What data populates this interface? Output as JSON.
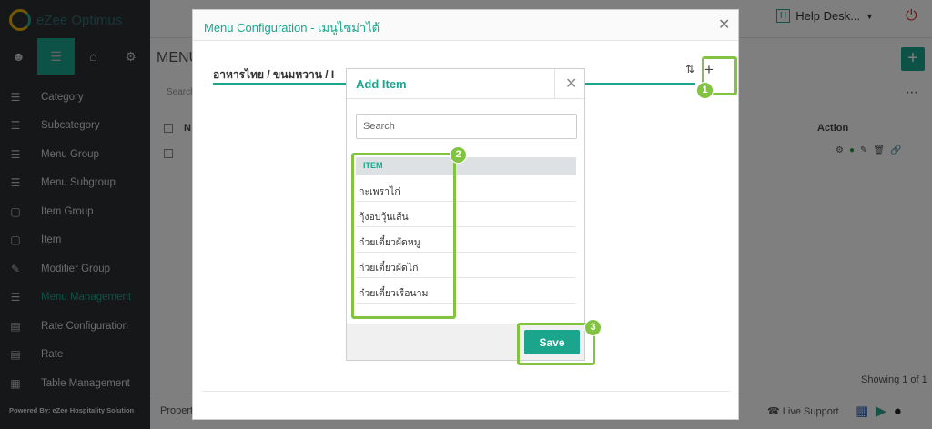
{
  "app": {
    "logo_text": "eZee Optimus",
    "powered_by": "Powered By: eZee Hospitality Solution"
  },
  "sidebar": {
    "tab_icons": [
      "user-icon",
      "list-icon",
      "store-icon",
      "gear-icon"
    ],
    "items": [
      {
        "label": "Category",
        "icon": "category-icon"
      },
      {
        "label": "Subcategory",
        "icon": "subcategory-icon"
      },
      {
        "label": "Menu Group",
        "icon": "menu-group-icon"
      },
      {
        "label": "Menu Subgroup",
        "icon": "menu-subgroup-icon"
      },
      {
        "label": "Item Group",
        "icon": "box-icon"
      },
      {
        "label": "Item",
        "icon": "box-icon"
      },
      {
        "label": "Modifier Group",
        "icon": "edit-icon"
      },
      {
        "label": "Menu Management",
        "icon": "list-icon"
      },
      {
        "label": "Rate Configuration",
        "icon": "rate-icon"
      },
      {
        "label": "Rate",
        "icon": "rate-icon"
      },
      {
        "label": "Table Management",
        "icon": "grid-icon"
      }
    ]
  },
  "header": {
    "help_desk": "Help Desk...",
    "help_box": "H"
  },
  "background": {
    "title": "MENU",
    "search": "Search",
    "col_n": "N",
    "action": "Action",
    "showing": "Showing 1 of 1",
    "live_support": "Live Support",
    "property": "Propert"
  },
  "menu_modal": {
    "title": "Menu Configuration - เมนูไซม่าไต้",
    "breadcrumb": "อาหารไทย /  ขนมหวาน /  I"
  },
  "add_item": {
    "title": "Add Item",
    "search_placeholder": "Search",
    "column_header": "ITEM",
    "items": [
      "กะเพราไก่",
      "กุ้งอบวุ้นเส้น",
      "ก๋วยเตี๋ยวผัดหมู",
      "ก๋วยเตี๋ยวผัดไก่",
      "ก๋วยเตี๋ยวเรือนาม"
    ],
    "save_label": "Save"
  },
  "annotations": {
    "badge_1": "1",
    "badge_2": "2",
    "badge_3": "3",
    "color": "#82c341"
  },
  "colors": {
    "accent": "#1ba58c",
    "sidebar": "#2a2f33"
  }
}
